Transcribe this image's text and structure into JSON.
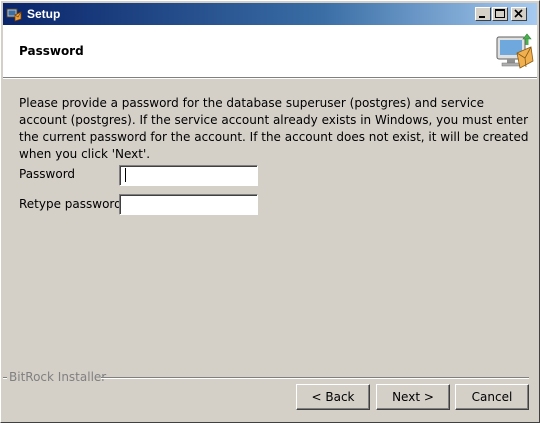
{
  "window": {
    "title": "Setup",
    "title_gradient_start": "#0a246a",
    "title_gradient_end": "#a6caf0",
    "background": "#d4d0c8",
    "icons": {
      "app": "setup-app-icon",
      "minimize": "minimize-icon",
      "maximize": "maximize-icon",
      "close": "close-icon"
    }
  },
  "header": {
    "title": "Password",
    "graphic": "computer-install-icon"
  },
  "main": {
    "description": "Please provide a password for the database superuser (postgres) and service account (postgres). If the service account already exists in Windows, you must enter the current password for the account. If the account does not exist, it will be created when you click 'Next'.",
    "fields": [
      {
        "label": "Password",
        "value": "",
        "placeholder": ""
      },
      {
        "label": "Retype password",
        "value": "",
        "placeholder": ""
      }
    ]
  },
  "footer": {
    "brand": "BitRock Installer",
    "back_label": "< Back",
    "next_label": "Next >",
    "cancel_label": "Cancel"
  }
}
